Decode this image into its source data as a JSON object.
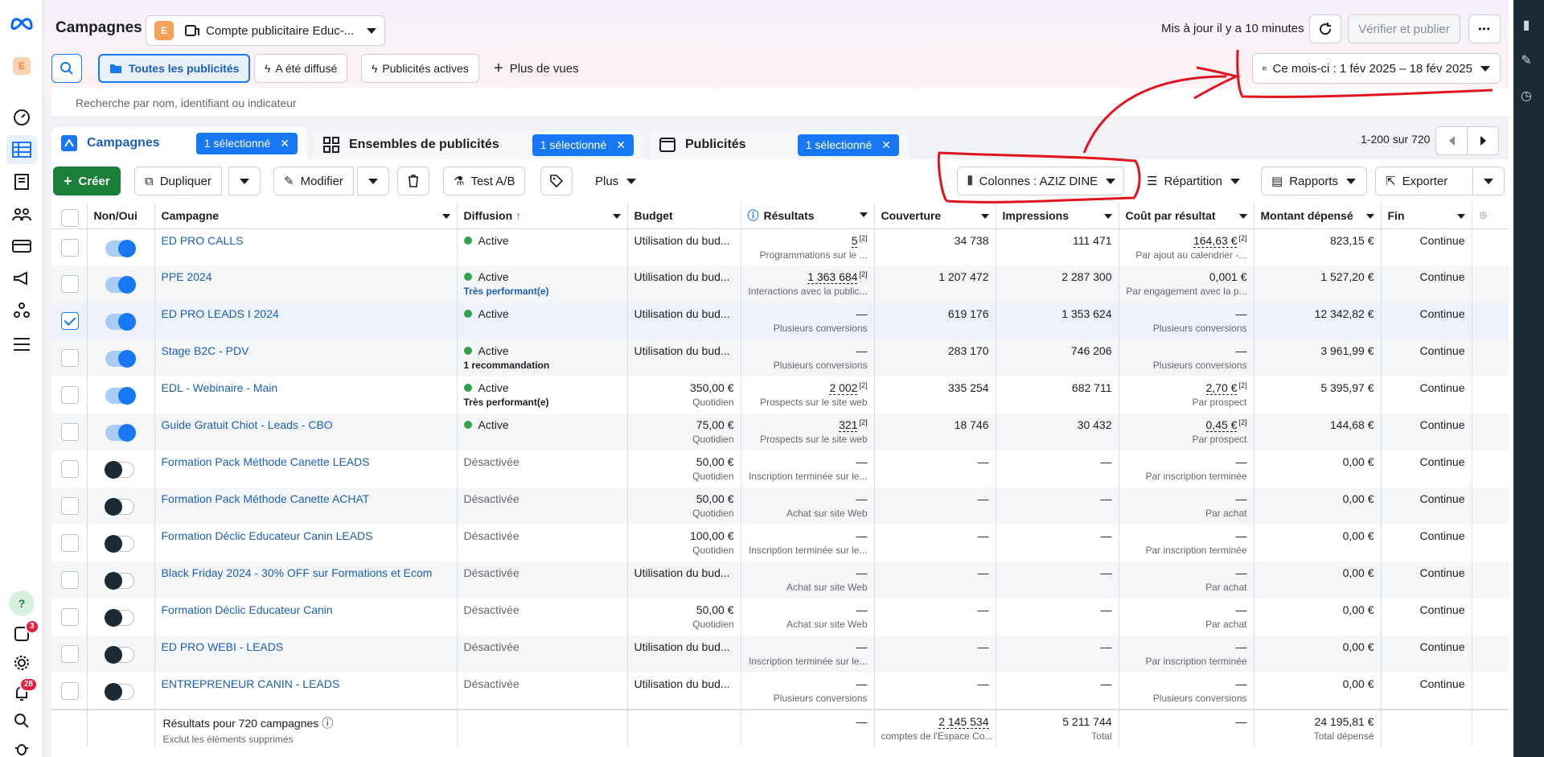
{
  "header": {
    "title": "Campagnes",
    "account_initial": "E",
    "account_name": "Compte publicitaire Educ-...",
    "status": "Mis à jour il y a 10 minutes",
    "publish_label": "Vérifier et publier",
    "more_label": "•••"
  },
  "filters": {
    "all_ads": "Toutes les publicités",
    "delivered": "A été diffusé",
    "active_ads": "Publicités actives",
    "more_views": "Plus de vues",
    "date_range": "Ce mois-ci : 1 fév 2025 – 18 fév 2025"
  },
  "search": {
    "placeholder": "Recherche par nom, identifiant ou indicateur"
  },
  "tabs": [
    {
      "label": "Campagnes",
      "selected": "1 sélectionné"
    },
    {
      "label": "Ensembles de publicités",
      "selected": "1 sélectionné"
    },
    {
      "label": "Publicités",
      "selected": "1 sélectionné"
    }
  ],
  "pager": {
    "range": "1-200 sur 720"
  },
  "toolbar": {
    "create": "Créer",
    "duplicate": "Dupliquer",
    "edit": "Modifier",
    "abtest": "Test A/B",
    "more": "Plus",
    "columns": "Colonnes : AZIZ DINE",
    "breakdown": "Répartition",
    "reports": "Rapports",
    "export": "Exporter"
  },
  "columns": [
    "Non/Oui",
    "Campagne",
    "Diffusion",
    "Budget",
    "Résultats",
    "Couverture",
    "Impressions",
    "Coût par résultat",
    "Montant dépensé",
    "Fin"
  ],
  "rows": [
    {
      "on": true,
      "checked": false,
      "name": "ED PRO CALLS",
      "status": "Active",
      "active": true,
      "tag": "",
      "tag_class": "",
      "budget": "Utilisation du bud...",
      "budget_sub": "",
      "results": "5",
      "results_ul": true,
      "results_sub": "Programmations sur le ...",
      "reach": "34 738",
      "impr": "111 471",
      "cpr": "164,63 €",
      "cpr_ul": true,
      "cpr_sub": "Par ajout au calendrier -...",
      "spent": "823,15 €",
      "end": "Continue"
    },
    {
      "on": true,
      "checked": false,
      "name": "PPE 2024",
      "status": "Active",
      "active": true,
      "tag": "Très performant(e)",
      "tag_class": "blue",
      "budget": "Utilisation du bud...",
      "budget_sub": "",
      "results": "1 363 684",
      "results_ul": true,
      "results_sub": "Interactions avec la public...",
      "reach": "1 207 472",
      "impr": "2 287 300",
      "cpr": "0,001 €",
      "cpr_ul": false,
      "cpr_sub": "Par engagement avec la p...",
      "spent": "1 527,20 €",
      "end": "Continue"
    },
    {
      "on": true,
      "checked": true,
      "name": "ED PRO LEADS I 2024",
      "status": "Active",
      "active": true,
      "tag": "",
      "tag_class": "",
      "budget": "Utilisation du bud...",
      "budget_sub": "",
      "results": "—",
      "results_ul": false,
      "results_sub": "Plusieurs conversions",
      "reach": "619 176",
      "impr": "1 353 624",
      "cpr": "—",
      "cpr_ul": false,
      "cpr_sub": "Plusieurs conversions",
      "spent": "12 342,82 €",
      "end": "Continue"
    },
    {
      "on": true,
      "checked": false,
      "name": "Stage B2C - PDV",
      "status": "Active",
      "active": true,
      "tag": "1 recommandation",
      "tag_class": "",
      "budget": "Utilisation du bud...",
      "budget_sub": "",
      "results": "—",
      "results_ul": false,
      "results_sub": "Plusieurs conversions",
      "reach": "283 170",
      "impr": "746 206",
      "cpr": "—",
      "cpr_ul": false,
      "cpr_sub": "Plusieurs conversions",
      "spent": "3 961,99 €",
      "end": "Continue"
    },
    {
      "on": true,
      "checked": false,
      "name": "EDL - Webinaire - Main",
      "status": "Active",
      "active": true,
      "tag": "Très performant(e)",
      "tag_class": "",
      "budget": "350,00 €",
      "budget_sub": "Quotidien",
      "results": "2 002",
      "results_ul": true,
      "results_sub": "Prospects sur le site web",
      "reach": "335 254",
      "impr": "682 711",
      "cpr": "2,70 €",
      "cpr_ul": true,
      "cpr_sub": "Par prospect",
      "spent": "5 395,97 €",
      "end": "Continue"
    },
    {
      "on": true,
      "checked": false,
      "name": "Guide Gratuit Chiot - Leads - CBO",
      "status": "Active",
      "active": true,
      "tag": "",
      "tag_class": "",
      "budget": "75,00 €",
      "budget_sub": "Quotidien",
      "results": "321",
      "results_ul": true,
      "results_sub": "Prospects sur le site web",
      "reach": "18 746",
      "impr": "30 432",
      "cpr": "0,45 €",
      "cpr_ul": true,
      "cpr_sub": "Par prospect",
      "spent": "144,68 €",
      "end": "Continue"
    },
    {
      "on": false,
      "checked": false,
      "name": "Formation Pack Méthode Canette LEADS",
      "status": "Désactivée",
      "active": false,
      "tag": "",
      "tag_class": "",
      "budget": "50,00 €",
      "budget_sub": "Quotidien",
      "results": "—",
      "results_ul": false,
      "results_sub": "Inscription terminée sur le...",
      "reach": "—",
      "impr": "—",
      "cpr": "—",
      "cpr_ul": false,
      "cpr_sub": "Par inscription terminée",
      "spent": "0,00 €",
      "end": "Continue"
    },
    {
      "on": false,
      "checked": false,
      "name": "Formation Pack Méthode Canette ACHAT",
      "status": "Désactivée",
      "active": false,
      "tag": "",
      "tag_class": "",
      "budget": "50,00 €",
      "budget_sub": "Quotidien",
      "results": "—",
      "results_ul": false,
      "results_sub": "Achat sur site Web",
      "reach": "—",
      "impr": "—",
      "cpr": "—",
      "cpr_ul": false,
      "cpr_sub": "Par achat",
      "spent": "0,00 €",
      "end": "Continue"
    },
    {
      "on": false,
      "checked": false,
      "name": "Formation Déclic Educateur Canin LEADS",
      "status": "Désactivée",
      "active": false,
      "tag": "",
      "tag_class": "",
      "budget": "100,00 €",
      "budget_sub": "Quotidien",
      "results": "—",
      "results_ul": false,
      "results_sub": "Inscription terminée sur le...",
      "reach": "—",
      "impr": "—",
      "cpr": "—",
      "cpr_ul": false,
      "cpr_sub": "Par inscription terminée",
      "spent": "0,00 €",
      "end": "Continue"
    },
    {
      "on": false,
      "checked": false,
      "name": "Black Friday 2024 - 30% OFF sur Formations et Ecom",
      "status": "Désactivée",
      "active": false,
      "tag": "",
      "tag_class": "",
      "budget": "Utilisation du bud...",
      "budget_sub": "",
      "results": "—",
      "results_ul": false,
      "results_sub": "Achat sur site Web",
      "reach": "—",
      "impr": "—",
      "cpr": "—",
      "cpr_ul": false,
      "cpr_sub": "Par achat",
      "spent": "0,00 €",
      "end": "Continue"
    },
    {
      "on": false,
      "checked": false,
      "name": "Formation Déclic Educateur Canin",
      "status": "Désactivée",
      "active": false,
      "tag": "",
      "tag_class": "",
      "budget": "50,00 €",
      "budget_sub": "Quotidien",
      "results": "—",
      "results_ul": false,
      "results_sub": "Achat sur site Web",
      "reach": "—",
      "impr": "—",
      "cpr": "—",
      "cpr_ul": false,
      "cpr_sub": "Par achat",
      "spent": "0,00 €",
      "end": "Continue"
    },
    {
      "on": false,
      "checked": false,
      "name": "ED PRO WEBI - LEADS",
      "status": "Désactivée",
      "active": false,
      "tag": "",
      "tag_class": "",
      "budget": "Utilisation du bud...",
      "budget_sub": "",
      "results": "—",
      "results_ul": false,
      "results_sub": "Inscription terminée sur le...",
      "reach": "—",
      "impr": "—",
      "cpr": "—",
      "cpr_ul": false,
      "cpr_sub": "Par inscription terminée",
      "spent": "0,00 €",
      "end": "Continue"
    },
    {
      "on": false,
      "checked": false,
      "name": "ENTREPRENEUR CANIN - LEADS",
      "status": "Désactivée",
      "active": false,
      "tag": "",
      "tag_class": "",
      "budget": "Utilisation du bud...",
      "budget_sub": "",
      "results": "—",
      "results_ul": false,
      "results_sub": "Plusieurs conversions",
      "reach": "—",
      "impr": "—",
      "cpr": "—",
      "cpr_ul": false,
      "cpr_sub": "Plusieurs conversions",
      "spent": "0,00 €",
      "end": "Continue"
    }
  ],
  "totals": {
    "label": "Résultats pour 720 campagnes",
    "sub": "Exclut les éléments supprimés",
    "results": "—",
    "reach": "2 145 534",
    "reach_sub": "comptes de l'Espace Co...",
    "impr": "5 211 744",
    "impr_sub": "Total",
    "cpr": "—",
    "spent": "24 195,81 €",
    "spent_sub": "Total dépensé"
  },
  "nav": {
    "help": "?",
    "notif_count": "3",
    "alerts_count": "28"
  },
  "colors": {
    "accent": "#1877f2",
    "create": "#1a7f37",
    "annotation": "#e0141e"
  }
}
